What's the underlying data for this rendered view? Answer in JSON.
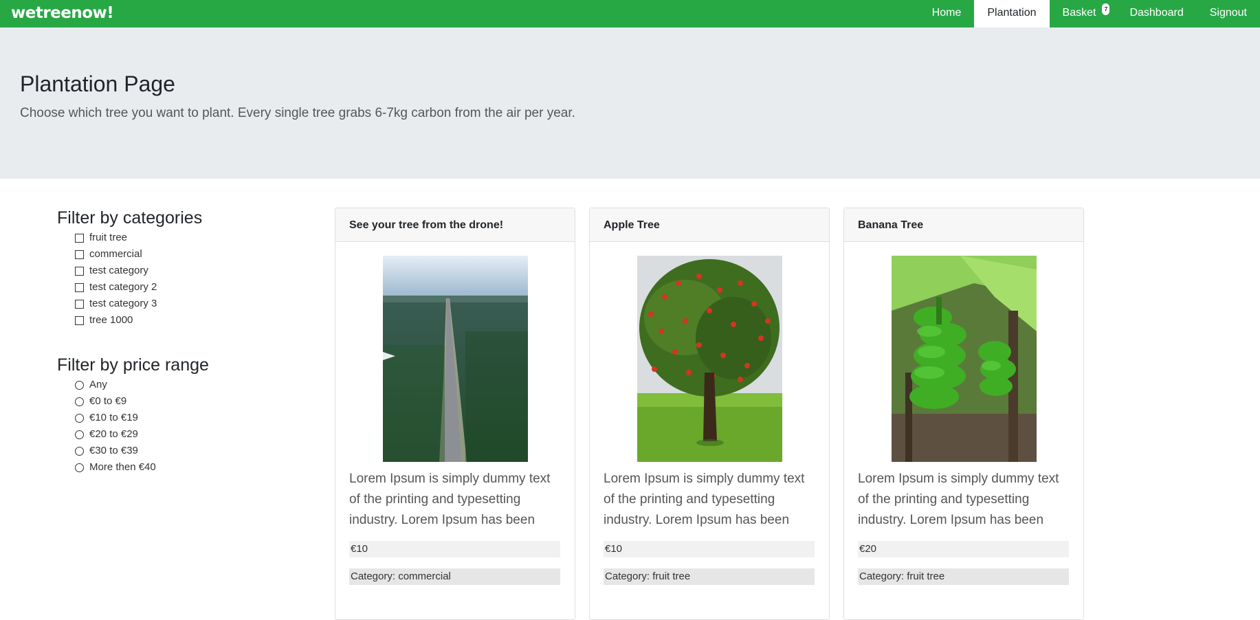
{
  "navbar": {
    "brand": "wetreenow!",
    "items": [
      {
        "label": "Home",
        "active": false
      },
      {
        "label": "Plantation",
        "active": true
      },
      {
        "label": "Basket",
        "active": false,
        "badge": "7"
      },
      {
        "label": "Dashboard",
        "active": false
      },
      {
        "label": "Signout",
        "active": false
      }
    ],
    "color": "#28a745"
  },
  "jumbotron": {
    "title": "Plantation Page",
    "subtitle": "Choose which tree you want to plant. Every single tree grabs 6-7kg carbon from the air per year."
  },
  "filters": {
    "categories_title": "Filter by categories",
    "categories": [
      "fruit tree",
      "commercial",
      "test category",
      "test category 2",
      "test category 3",
      "tree 1000"
    ],
    "price_title": "Filter by price range",
    "price_ranges": [
      "Any",
      "€0 to €9",
      "€10 to €19",
      "€20 to €29",
      "€30 to €39",
      "More then €40"
    ]
  },
  "products": [
    {
      "title": "See your tree from the drone!",
      "image": "aerial-forest-road-photo",
      "description": "Lorem Ipsum is simply dummy text of the printing and typesetting industry. Lorem Ipsum has been the",
      "price": "€10",
      "category": "Category: commercial"
    },
    {
      "title": "Apple Tree",
      "image": "apple-tree-photo",
      "description": "Lorem Ipsum is simply dummy text of the printing and typesetting industry. Lorem Ipsum has been the",
      "price": "€10",
      "category": "Category: fruit tree"
    },
    {
      "title": "Banana Tree",
      "image": "banana-tree-photo",
      "description": "Lorem Ipsum is simply dummy text of the printing and typesetting industry. Lorem Ipsum has been the",
      "price": "€20",
      "category": "Category: fruit tree"
    }
  ]
}
